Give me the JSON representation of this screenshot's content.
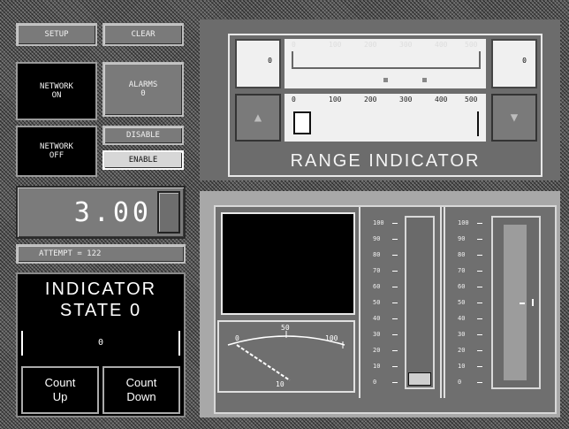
{
  "left_panel": {
    "top_buttons": [
      "SETUP",
      "CLEAR"
    ],
    "status": {
      "box1_line1": "NETWORK",
      "box1_line2": "ON",
      "box2_line1": "ALARMS",
      "box2_line2": "0",
      "box3_line1": "NETWORK",
      "box3_line2": "OFF",
      "small_btn1": "DISABLE",
      "small_btn2": "ENABLE"
    },
    "display_value": "3.00",
    "attempt_label": "ATTEMPT = 122",
    "indicator": {
      "title_line1": "INDICATOR",
      "title_line2": "STATE 0",
      "value": "0",
      "count_up": [
        "Count",
        "Up"
      ],
      "count_down": [
        "Count",
        "Down"
      ]
    }
  },
  "range_panel": {
    "label": "RANGE INDICATOR",
    "top_scale_labels": [
      "0",
      "100",
      "200",
      "300",
      "400",
      "500"
    ],
    "bottom_scale_labels": [
      "0",
      "100",
      "200",
      "300",
      "400",
      "500"
    ],
    "left_box_value": "0",
    "right_box_value": "0",
    "up_arrow": "▲",
    "down_arrow": "▼"
  },
  "meter_panel": {
    "dial_labels": [
      "0",
      "50",
      "100"
    ],
    "dial_value_label": "10",
    "bar1_ticks": [
      "100",
      "90",
      "80",
      "70",
      "60",
      "50",
      "40",
      "30",
      "20",
      "10",
      "0"
    ],
    "bar2_ticks": [
      "100",
      "90",
      "80",
      "70",
      "60",
      "50",
      "40",
      "30",
      "20",
      "10",
      "0"
    ],
    "bar1_level": 0.08,
    "bar2_level": 0.92
  }
}
